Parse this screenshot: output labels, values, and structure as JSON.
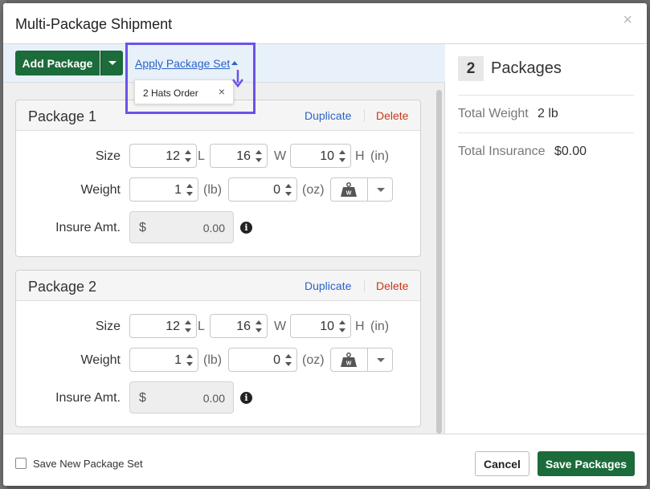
{
  "modal": {
    "title": "Multi-Package Shipment",
    "close_glyph": "×"
  },
  "toolbar": {
    "add_label": "Add Package",
    "apply_label": "Apply Package Set",
    "dropdown_option": "2 Hats Order",
    "dropdown_remove": "×"
  },
  "packages": [
    {
      "title": "Package 1",
      "duplicate": "Duplicate",
      "delete": "Delete",
      "size_label": "Size",
      "length": "12",
      "length_unit": "L",
      "width": "16",
      "width_unit": "W",
      "height": "10",
      "height_unit": "H",
      "dim_unit": "(in)",
      "weight_label": "Weight",
      "lb": "1",
      "lb_unit": "(lb)",
      "oz": "0",
      "oz_unit": "(oz)",
      "insure_label": "Insure Amt.",
      "currency": "$",
      "insure_amt": "0.00",
      "info_glyph": "i"
    },
    {
      "title": "Package 2",
      "duplicate": "Duplicate",
      "delete": "Delete",
      "size_label": "Size",
      "length": "12",
      "length_unit": "L",
      "width": "16",
      "width_unit": "W",
      "height": "10",
      "height_unit": "H",
      "dim_unit": "(in)",
      "weight_label": "Weight",
      "lb": "1",
      "lb_unit": "(lb)",
      "oz": "0",
      "oz_unit": "(oz)",
      "insure_label": "Insure Amt.",
      "currency": "$",
      "insure_amt": "0.00",
      "info_glyph": "i"
    }
  ],
  "summary": {
    "count": "2",
    "count_label": "Packages",
    "weight_label": "Total Weight",
    "weight_value": "2 lb",
    "insurance_label": "Total Insurance",
    "insurance_value": "$0.00"
  },
  "footer": {
    "save_set_label": "Save New Package Set",
    "cancel_label": "Cancel",
    "save_label": "Save Packages"
  },
  "colors": {
    "primary_green": "#1c6b3a",
    "link_blue": "#2b63c7",
    "delete_red": "#c7381b",
    "highlight_purple": "#6c52e8"
  },
  "icons": {
    "close": "close-icon",
    "add_caret": "chevron-down-icon",
    "apply_caret": "caret-up-icon",
    "scale": "scale-icon",
    "info": "info-icon",
    "annotation_arrow": "arrow-down-icon"
  }
}
